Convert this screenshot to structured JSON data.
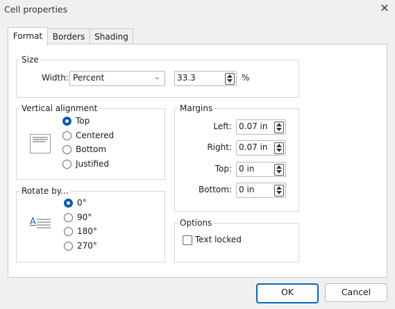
{
  "window": {
    "title": "Cell properties"
  },
  "tabs": [
    {
      "label": "Format",
      "active": true
    },
    {
      "label": "Borders",
      "active": false
    },
    {
      "label": "Shading",
      "active": false
    }
  ],
  "size": {
    "legend": "Size",
    "width_label": "Width:",
    "unit_value": "Percent",
    "value": "33.3",
    "suffix": "%"
  },
  "vertical_alignment": {
    "legend": "Vertical alignment",
    "options": [
      {
        "label": "Top",
        "selected": true
      },
      {
        "label": "Centered",
        "selected": false
      },
      {
        "label": "Bottom",
        "selected": false
      },
      {
        "label": "Justified",
        "selected": false
      }
    ]
  },
  "rotate": {
    "legend": "Rotate by...",
    "preview_letter": "A",
    "options": [
      {
        "label": "0°",
        "selected": true
      },
      {
        "label": "90°",
        "selected": false
      },
      {
        "label": "180°",
        "selected": false
      },
      {
        "label": "270°",
        "selected": false
      }
    ]
  },
  "margins": {
    "legend": "Margins",
    "fields": [
      {
        "label": "Left:",
        "value": "0.07 in"
      },
      {
        "label": "Right:",
        "value": "0.07 in"
      },
      {
        "label": "Top:",
        "value": "0 in"
      },
      {
        "label": "Bottom:",
        "value": "0 in"
      }
    ]
  },
  "options": {
    "legend": "Options",
    "text_locked_label": "Text locked",
    "text_locked_checked": false
  },
  "buttons": {
    "ok": "OK",
    "cancel": "Cancel"
  },
  "colors": {
    "accent": "#0067c0",
    "radio_selected": "#0b5cad"
  }
}
